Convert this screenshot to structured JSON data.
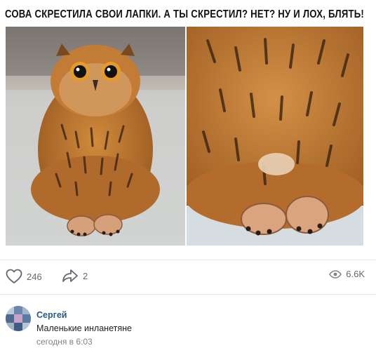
{
  "post": {
    "caption": "СОВА СКРЕСТИЛА СВОИ ЛАПКИ. А ТЫ СКРЕСТИЛ? НЕТ? НУ И ЛОХ, БЛЯТЬ!",
    "image_description_icons": [
      "owl-left-photo",
      "owl-right-photo"
    ]
  },
  "actions": {
    "likes": "246",
    "shares": "2",
    "views": "6.6K",
    "icons": {
      "like": "heart-icon",
      "share": "share-arrow-icon",
      "views": "eye-icon"
    }
  },
  "comment": {
    "author": "Сергей",
    "text": "Маленькие инланетяне",
    "time": "сегодня в 6:03"
  },
  "colors": {
    "link": "#2a5885",
    "muted": "#828282",
    "icon": "#63676d",
    "owl_brown": "#b5742f"
  }
}
